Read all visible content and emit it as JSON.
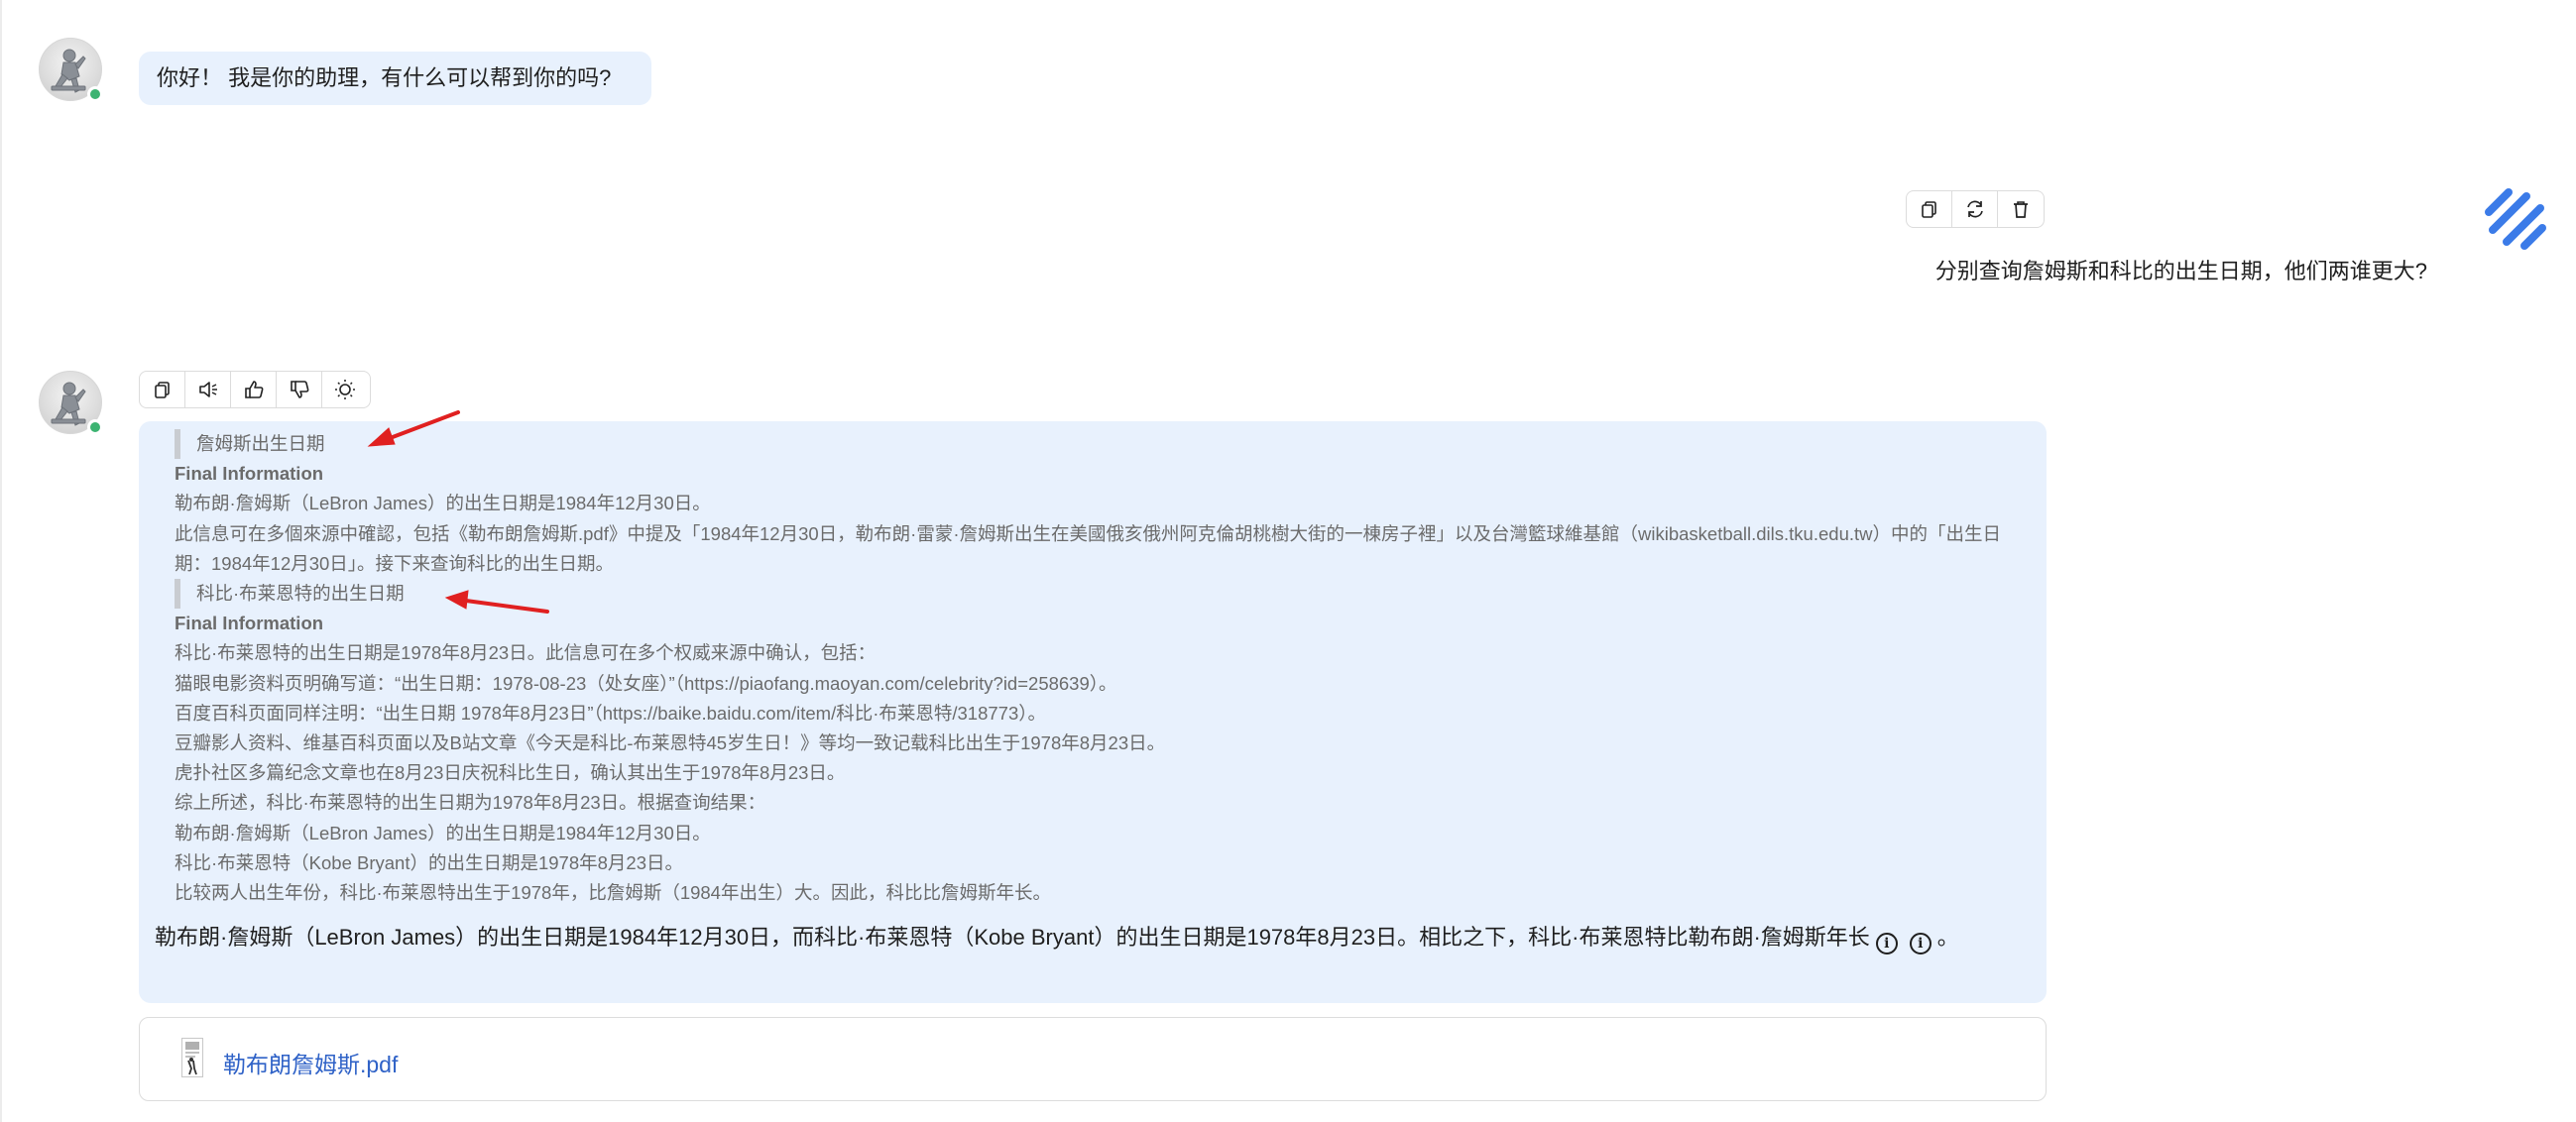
{
  "colors": {
    "bubble_bg": "#e8f1fd",
    "online": "#3cb371",
    "link": "#2f62c7",
    "annotation_arrow": "#e02020",
    "brand_stripes": "#3b7be8"
  },
  "icons": {
    "assistant_avatar": "robot-thinker-icon",
    "user_avatar": "brand-stripes-icon"
  },
  "greeting": {
    "text": "你好！ 我是你的助理，有什么可以帮到你的吗?"
  },
  "user_message": {
    "text": "分别查询詹姆斯和科比的出生日期，他们两谁更大?",
    "actions": [
      "copy-icon",
      "refresh-icon",
      "delete-icon"
    ]
  },
  "assistant_message": {
    "actions": [
      "copy-icon",
      "speaker-icon",
      "thumbs-up-icon",
      "thumbs-down-icon",
      "lightbulb-icon"
    ],
    "thinking": {
      "step1_title": "詹姆斯出生日期",
      "step1_final_label": "Final Information",
      "step1_lines": [
        "勒布朗·詹姆斯（LeBron James）的出生日期是1984年12月30日。",
        "此信息可在多個來源中確認，包括《勒布朗詹姆斯.pdf》中提及「1984年12月30日，勒布朗·雷蒙·詹姆斯出生在美國俄亥俄州阿克倫胡桃樹大街的一棟房子裡」以及台灣籃球維基館（wikibasketball.dils.tku.edu.tw）中的「出生日期：1984年12月30日」。接下来查询科比的出生日期。"
      ],
      "step2_title": "科比·布莱恩特的出生日期",
      "step2_final_label": "Final Information",
      "step2_lines": [
        "科比·布莱恩特的出生日期是1978年8月23日。此信息可在多个权威来源中确认，包括：",
        "猫眼电影资料页明确写道：“出生日期：1978-08-23（处女座）”（https://piaofang.maoyan.com/celebrity?id=258639）。",
        "百度百科页面同样注明：“出生日期 1978年8月23日”（https://baike.baidu.com/item/科比·布莱恩特/318773）。",
        "豆瓣影人资料、维基百科页面以及B站文章《今天是科比-布莱恩特45岁生日！》等均一致记载科比出生于1978年8月23日。",
        "虎扑社区多篇纪念文章也在8月23日庆祝科比生日，确认其出生于1978年8月23日。",
        "综上所述，科比·布莱恩特的出生日期为1978年8月23日。根据查询结果：",
        "勒布朗·詹姆斯（LeBron James）的出生日期是1984年12月30日。",
        "科比·布莱恩特（Kobe Bryant）的出生日期是1978年8月23日。",
        "比较两人出生年份，科比·布莱恩特出生于1978年，比詹姆斯（1984年出生）大。因此，科比比詹姆斯年长。"
      ]
    },
    "answer": "勒布朗·詹姆斯（LeBron James）的出生日期是1984年12月30日，而科比·布莱恩特（Kobe Bryant）的出生日期是1978年8月23日。相比之下，科比·布莱恩特比勒布朗·詹姆斯年长",
    "answer_end": "。",
    "citation_icon": "info-icon",
    "citation_symbol": "i"
  },
  "attachment": {
    "icon": "pdf-file-icon",
    "filename": "勒布朗詹姆斯.pdf"
  }
}
